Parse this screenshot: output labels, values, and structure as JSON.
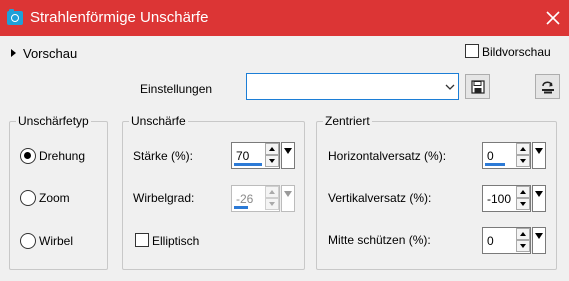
{
  "window": {
    "title": "Strahlenförmige Unschärfe",
    "accent_color": "#dc3535",
    "app_icon": "camera-icon",
    "close_icon": "close-icon"
  },
  "preview": {
    "toggle_label": "Vorschau",
    "bildvorschau_label": "Bildvorschau",
    "bildvorschau_checked": false
  },
  "settings": {
    "label": "Einstellungen",
    "value": "",
    "save_icon": "save-icon",
    "reset_icon": "reset-icon"
  },
  "blur_type": {
    "title": "Unschärfetyp",
    "options": [
      {
        "label": "Drehung",
        "checked": true
      },
      {
        "label": "Zoom",
        "checked": false
      },
      {
        "label": "Wirbel",
        "checked": false
      }
    ]
  },
  "blur": {
    "title": "Unschärfe",
    "staerke_label": "Stärke (%):",
    "staerke_value": "70",
    "staerke_fill": 0.7,
    "wirbelgrad_label": "Wirbelgrad:",
    "wirbelgrad_value": "-26",
    "wirbelgrad_fill": 0.36,
    "wirbelgrad_enabled": false,
    "elliptisch_label": "Elliptisch",
    "elliptisch_checked": false
  },
  "center": {
    "title": "Zentriert",
    "horizontal_label": "Horizontalversatz (%):",
    "horizontal_value": "0",
    "horizontal_fill": 0.5,
    "vertikal_label": "Vertikalversatz (%):",
    "vertikal_value": "-100",
    "vertikal_fill": 0,
    "mitte_label": "Mitte schützen (%):",
    "mitte_value": "0",
    "mitte_fill": 0
  }
}
